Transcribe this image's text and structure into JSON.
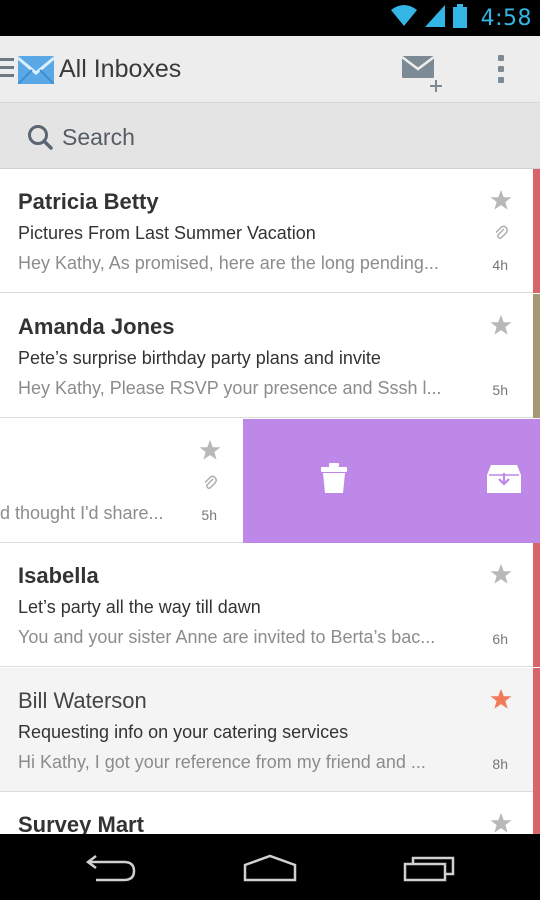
{
  "status": {
    "time": "4:58"
  },
  "header": {
    "title": "All Inboxes"
  },
  "search": {
    "placeholder": "Search"
  },
  "messages": [
    {
      "sender": "Patricia Betty",
      "subject": "Pictures From Last Summer Vacation",
      "preview": "Hey Kathy, As promised, here are the long pending...",
      "time": "4h",
      "starred": false,
      "attachment": true,
      "accent": "#d9656a"
    },
    {
      "sender": "Amanda Jones",
      "subject": "Pete’s surprise birthday party plans and invite",
      "preview": "Hey Kathy, Please RSVP your presence and Sssh l...",
      "time": "5h",
      "starred": false,
      "attachment": false,
      "accent": "#a89878"
    },
    {
      "sender": "",
      "subject": "",
      "preview": "d thought I'd share...",
      "time": "5h",
      "starred": false,
      "attachment": true,
      "accent": ""
    },
    {
      "sender": "Isabella",
      "subject": "Let’s party all the way till dawn",
      "preview": "You and your sister Anne are invited to Berta’s bac...",
      "time": "6h",
      "starred": false,
      "attachment": false,
      "accent": "#d9656a"
    },
    {
      "sender": "Bill Waterson",
      "subject": "Requesting info on your catering services",
      "preview": "Hi Kathy, I got your reference from my friend and ...",
      "time": "8h",
      "starred": true,
      "attachment": false,
      "accent": "#d9656a"
    },
    {
      "sender": "Survey Mart",
      "subject": "",
      "preview": "",
      "time": "",
      "starred": false,
      "attachment": false,
      "accent": "#d9656a"
    }
  ],
  "swipe": {
    "color": "#be88e8",
    "left_icon": "trash-icon",
    "right_icon": "archive-icon"
  },
  "colors": {
    "star_active": "#f07a5a",
    "star_inactive": "#b8b8b8",
    "status_accent": "#33b5e5"
  }
}
